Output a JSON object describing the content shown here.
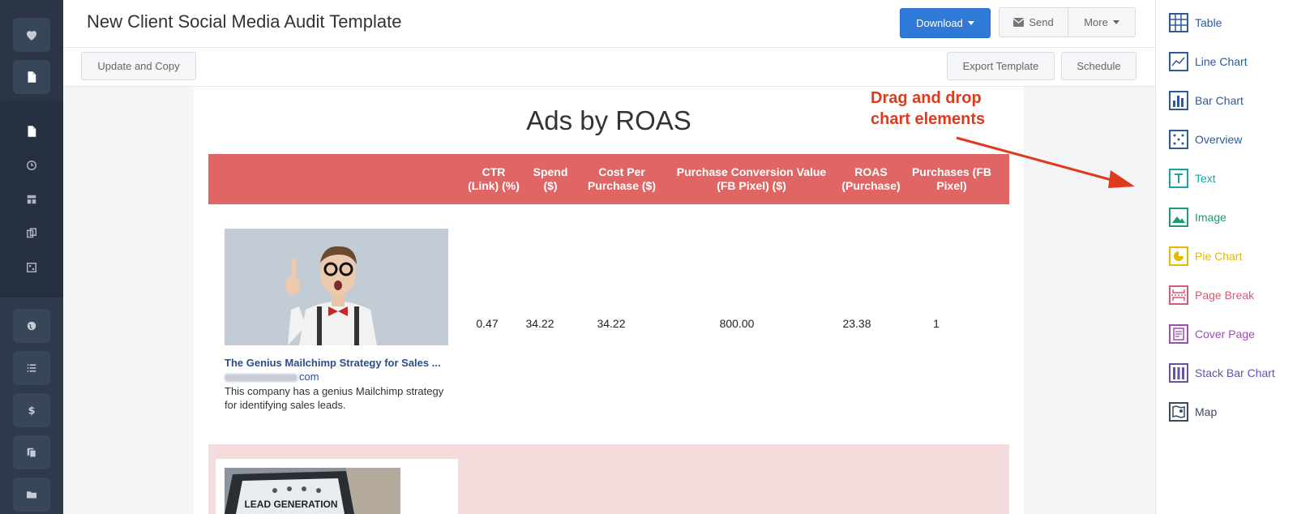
{
  "header": {
    "title": "New Client Social Media Audit Template",
    "download_label": "Download",
    "send_label": "Send",
    "more_label": "More"
  },
  "toolbar": {
    "update_copy_label": "Update and Copy",
    "export_label": "Export Template",
    "schedule_label": "Schedule"
  },
  "leftnav": {
    "icons": [
      "heart-icon",
      "document-icon",
      "document-icon",
      "clock-icon",
      "layout-icon",
      "copy-icon",
      "grid-icon",
      "globe-icon",
      "list-icon",
      "dollar-icon",
      "duplicate-icon",
      "folder-icon"
    ]
  },
  "report": {
    "title": "Ads by ROAS",
    "columns": [
      {
        "line1": "CTR",
        "line2": "(Link) (%)"
      },
      {
        "line1": "Spend",
        "line2": "($)"
      },
      {
        "line1": "Cost Per",
        "line2": "Purchase ($)"
      },
      {
        "line1": "Purchase Conversion Value",
        "line2": "(FB Pixel) ($)"
      },
      {
        "line1": "ROAS",
        "line2": "(Purchase)"
      },
      {
        "line1": "Purchases (FB",
        "line2": "Pixel)"
      }
    ],
    "rows": [
      {
        "ad_title": "The Genius Mailchimp Strategy for Sales ...",
        "ad_domain_suffix": "com",
        "ad_description": "This company has a genius Mailchimp strategy for identifying sales leads.",
        "values": [
          "0.47",
          "34.22",
          "34.22",
          "800.00",
          "23.38",
          "1"
        ]
      },
      {
        "image_text": "LEAD GENERATION"
      }
    ]
  },
  "annotation": {
    "line1": "Drag and drop",
    "line2": "chart elements",
    "color": "#e03a1e"
  },
  "elements_panel": {
    "items": [
      {
        "label": "Table",
        "icon": "table-icon",
        "color": "#2c5a9c"
      },
      {
        "label": "Line Chart",
        "icon": "line-chart-icon",
        "color": "#2c5a9c"
      },
      {
        "label": "Bar Chart",
        "icon": "bar-chart-icon",
        "color": "#2c5a9c"
      },
      {
        "label": "Overview",
        "icon": "overview-icon",
        "color": "#2c5a9c"
      },
      {
        "label": "Text",
        "icon": "text-icon",
        "color": "#1aa3a6"
      },
      {
        "label": "Image",
        "icon": "image-icon",
        "color": "#1b9e6c"
      },
      {
        "label": "Pie Chart",
        "icon": "pie-chart-icon",
        "color": "#e6b800"
      },
      {
        "label": "Page Break",
        "icon": "page-break-icon",
        "color": "#d65a72"
      },
      {
        "label": "Cover Page",
        "icon": "cover-page-icon",
        "color": "#9b4fb0"
      },
      {
        "label": "Stack Bar Chart",
        "icon": "stack-bar-chart-icon",
        "color": "#6a4fa8"
      },
      {
        "label": "Map",
        "icon": "map-icon",
        "color": "#3c4a5c"
      }
    ]
  },
  "colors": {
    "table_header": "#e06666",
    "primary_button": "#2f7ad8",
    "nav_background": "#2f3a4c"
  }
}
